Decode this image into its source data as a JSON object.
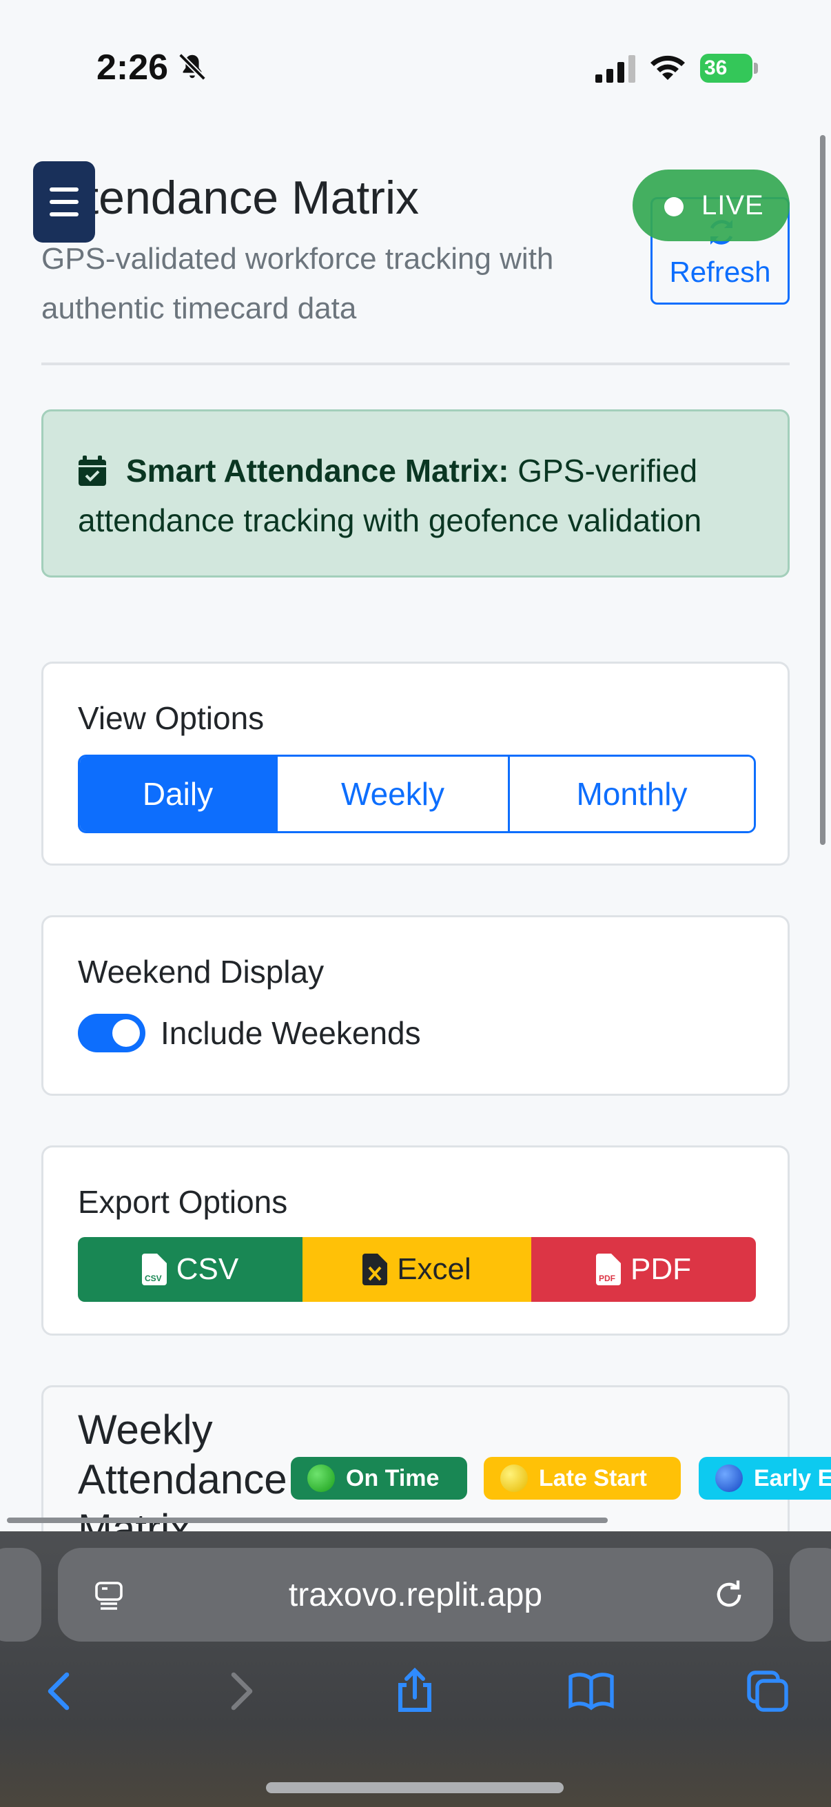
{
  "status_bar": {
    "time": "2:26",
    "battery": "36"
  },
  "header": {
    "title": "Attendance Matrix",
    "subtitle": "GPS-validated workforce tracking with authentic timecard data",
    "refresh_label": "Refresh",
    "live_label": "LIVE"
  },
  "alert": {
    "strong": "Smart Attendance Matrix:",
    "text": " GPS-verified attendance tracking with geofence validation"
  },
  "view_options": {
    "title": "View Options",
    "options": [
      "Daily",
      "Weekly",
      "Monthly"
    ],
    "selected": "Daily"
  },
  "weekend": {
    "title": "Weekend Display",
    "toggle_label": "Include Weekends",
    "enabled": true
  },
  "export": {
    "title": "Export Options",
    "csv": "CSV",
    "excel": "Excel",
    "pdf": "PDF"
  },
  "matrix": {
    "title": "Weekly Attendance Matrix",
    "legend": [
      "On Time",
      "Late Start",
      "Early E"
    ]
  },
  "browser": {
    "url": "traxovo.replit.app"
  },
  "colors": {
    "primary": "#0d6efd",
    "success": "#198754",
    "warning": "#ffc107",
    "danger": "#dc3545",
    "info": "#0dcaf0",
    "live": "#34a853",
    "menu": "#19305a"
  }
}
